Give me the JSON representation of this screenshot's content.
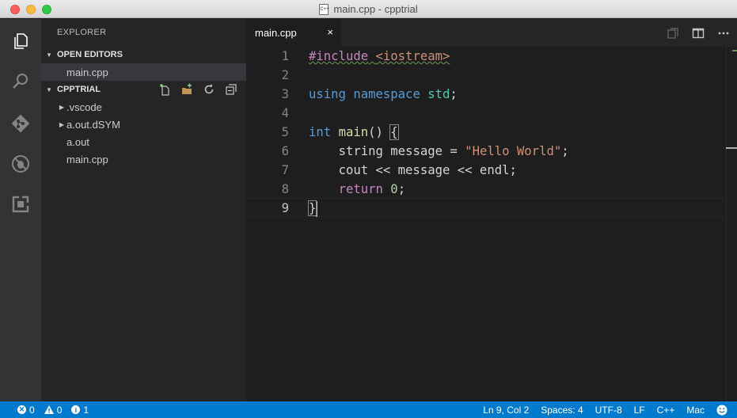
{
  "window": {
    "title": "main.cpp - cpptrial",
    "file_badge": "C++"
  },
  "activity_bar": {
    "items": [
      {
        "name": "explorer-icon"
      },
      {
        "name": "search-icon"
      },
      {
        "name": "source-control-icon"
      },
      {
        "name": "debug-icon"
      },
      {
        "name": "extensions-icon"
      }
    ]
  },
  "sidebar": {
    "title": "EXPLORER",
    "open_editors": {
      "label": "OPEN EDITORS",
      "items": [
        "main.cpp"
      ]
    },
    "project": {
      "label": "CPPTRIAL",
      "items": [
        {
          "label": ".vscode",
          "folder": true
        },
        {
          "label": "a.out.dSYM",
          "folder": true
        },
        {
          "label": "a.out",
          "folder": false
        },
        {
          "label": "main.cpp",
          "folder": false
        }
      ]
    }
  },
  "tabs": [
    {
      "label": "main.cpp",
      "close": "×"
    }
  ],
  "editor": {
    "line_numbers": [
      "1",
      "2",
      "3",
      "4",
      "5",
      "6",
      "7",
      "8",
      "9"
    ],
    "lines": {
      "l1_directive": "#include",
      "l1_header": "<iostream>",
      "l3_using": "using",
      "l3_namespace": "namespace",
      "l3_std": "std",
      "l3_semi": ";",
      "l5_int": "int",
      "l5_main": "main",
      "l5_parens": "() ",
      "l5_brace": "{",
      "l6_indent": "    ",
      "l6_type": "string",
      "l6_mid": " message = ",
      "l6_str": "\"Hello World\"",
      "l6_semi": ";",
      "l7_text": "    cout << message << endl;",
      "l8_indent": "    ",
      "l8_return": "return",
      "l8_sp": " ",
      "l8_num": "0",
      "l8_semi": ";",
      "l9_brace": "}"
    }
  },
  "status": {
    "errors": "0",
    "warnings": "0",
    "infos": "1",
    "position": "Ln 9, Col 2",
    "spaces": "Spaces: 4",
    "encoding": "UTF-8",
    "eol": "LF",
    "language": "C++",
    "platform": "Mac"
  },
  "colors": {
    "accent": "#007acc",
    "keyword": "#569cd6",
    "control": "#c586c0",
    "type": "#4ec9b0",
    "function": "#dcdcaa",
    "string": "#ce9178",
    "number": "#b5cea8"
  }
}
